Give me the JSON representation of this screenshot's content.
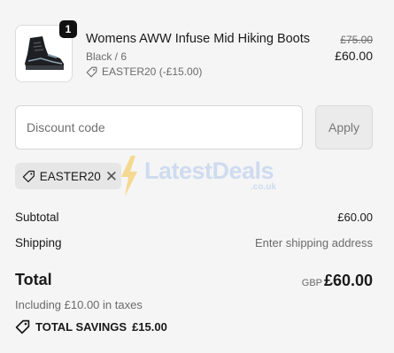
{
  "product": {
    "quantity": "1",
    "title": "Womens AWW Infuse Mid Hiking Boots",
    "variant": "Black / 6",
    "discount_applied": "EASTER20 (-£15.00)",
    "original_price": "£75.00",
    "price": "£60.00",
    "image_icon": "hiking-boot"
  },
  "discount": {
    "placeholder": "Discount code",
    "apply_label": "Apply",
    "applied_code": "EASTER20",
    "remove_icon": "close-icon"
  },
  "watermark": {
    "text": "LatestDeals",
    "sub": ".co.uk"
  },
  "summary": {
    "subtotal_label": "Subtotal",
    "subtotal_value": "£60.00",
    "shipping_label": "Shipping",
    "shipping_value": "Enter shipping address",
    "total_label": "Total",
    "total_currency": "GBP",
    "total_value": "£60.00",
    "taxes_note": "Including £10.00 in taxes",
    "savings_label": "TOTAL SAVINGS",
    "savings_value": "£15.00"
  },
  "colors": {
    "background": "#f5f5f5",
    "badge": "#111111",
    "watermark": "#c9d7ef",
    "watermark_bolt": "#f5c44e"
  }
}
